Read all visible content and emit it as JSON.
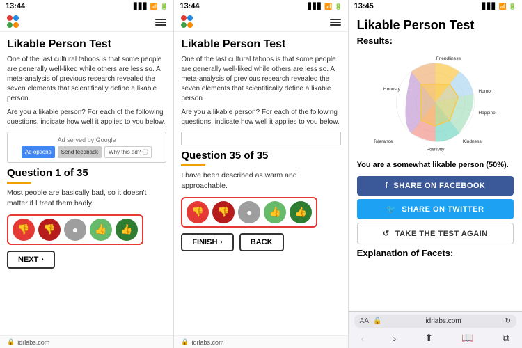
{
  "panel1": {
    "status_time": "13:44",
    "title": "Likable Person Test",
    "description": "One of the last cultural taboos is that some people are generally well-liked while others are less so. A meta-analysis of previous research revealed the seven elements that scientifically define a likable person.",
    "description2": "Are you a likable person? For each of the following questions, indicate how well it applies to you below.",
    "ad_label": "Ad served by Google",
    "ad_options": "Ad options",
    "ad_feedback": "Send feedback",
    "ad_why": "Why this ad? ⓘ",
    "question_header": "Question 1 of 35",
    "question_text": "Most people are basically bad, so it doesn't matter if I treat them badly.",
    "next_label": "NEXT",
    "footer": "idrlabs.com",
    "rating_buttons": [
      "👎",
      "👎",
      "●",
      "👍",
      "👍"
    ]
  },
  "panel2": {
    "status_time": "13:44",
    "title": "Likable Person Test",
    "description": "One of the last cultural taboos is that some people are generally well-liked while others are less so. A meta-analysis of previous research revealed the seven elements that scientifically define a likable person.",
    "description2": "Are you a likable person? For each of the following questions, indicate how well it applies to you below.",
    "question_header": "Question 35 of 35",
    "question_text": "I have been described as warm and approachable.",
    "finish_label": "FINISH",
    "back_label": "BACK",
    "footer": "idrlabs.com"
  },
  "panel3": {
    "status_time": "13:45",
    "title": "Likable Person Test",
    "results_label": "Results:",
    "result_text": "You are a somewhat likable person (50%).",
    "facebook_label": "SHARE ON FACEBOOK",
    "twitter_label": "SHARE ON TWITTER",
    "retake_label": "TAKE THE TEST AGAIN",
    "explanation_header": "Explanation of Facets:",
    "url_aa": "AA",
    "url_domain": "idrlabs.com",
    "chart_labels": {
      "friendliness": "Friendliness",
      "humor": "Humor",
      "happiness": "Happiness",
      "kindness": "Kindness",
      "positivity": "Positivity",
      "tolerance": "Tolerance",
      "honesty": "Honesty"
    },
    "chart_values": {
      "friendliness": 0.65,
      "humor": 0.55,
      "happiness": 0.45,
      "kindness": 0.5,
      "positivity": 0.55,
      "tolerance": 0.45,
      "honesty": 0.5
    },
    "icons": {
      "facebook": "f",
      "twitter": "t",
      "retake": "↺"
    }
  }
}
